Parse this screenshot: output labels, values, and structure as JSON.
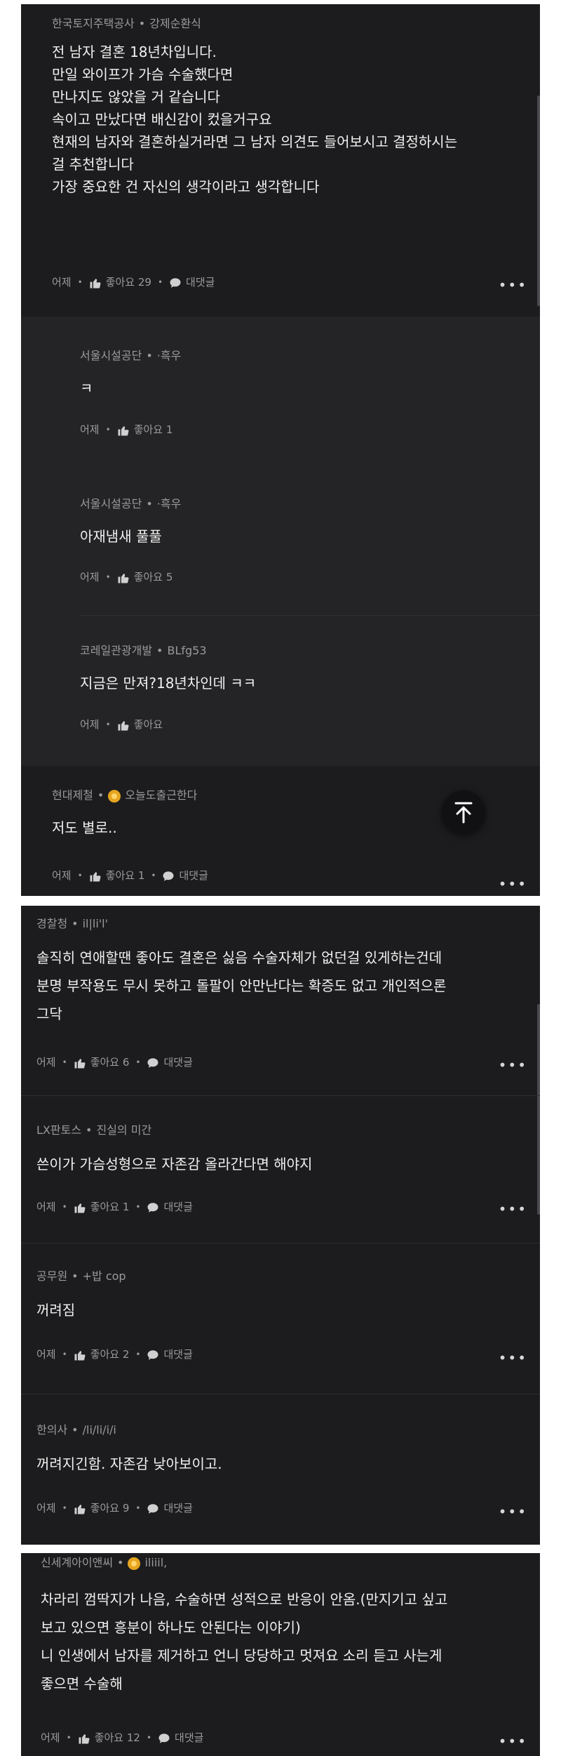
{
  "panel1": {
    "c1": {
      "company": "한국토지주택공사",
      "nick": "강제순환식",
      "lines": [
        "전 남자 결혼 18년차입니다.",
        "만일 와이프가 가슴 수술했다면",
        "만나지도 않았을 거 같습니다",
        "속이고 만났다면 배신감이 컸을거구요",
        "현재의 남자와 결혼하실거라면 그 남자 의견도 들어보시고 결정하시는",
        "걸 추천합니다",
        "가장 중요한 건 자신의 생각이라고 생각합니다"
      ],
      "time": "어제",
      "like": "좋아요 29",
      "reply": "대댓글"
    },
    "r1": {
      "company": "서울시설공단",
      "nick": "·흑우",
      "text": "ㅋ",
      "time": "어제",
      "like": "좋아요 1"
    },
    "r2": {
      "company": "서울시설공단",
      "nick": "·흑우",
      "text": "아재냄새 풀풀",
      "time": "어제",
      "like": "좋아요 5"
    },
    "r3": {
      "company": "코레일관광개발",
      "nick": "BLfg53",
      "text": "지금은 만져?18년차인데 ㅋㅋ",
      "time": "어제",
      "like": "좋아요"
    },
    "c2": {
      "company": "현대제철",
      "nick": "오늘도출근한다",
      "text": "저도 별로..",
      "time": "어제",
      "like": "좋아요 1",
      "reply": "대댓글"
    }
  },
  "panel2": {
    "c1": {
      "company": "경찰청",
      "nick": "il|li'l'",
      "lines": [
        "솔직히 연애할땐 좋아도 결혼은 싫음 수술자체가 없던걸 있게하는건데",
        "분명 부작용도 무시 못하고 돌팔이 안만난다는 확증도 없고 개인적으론",
        "그닥"
      ],
      "time": "어제",
      "like": "좋아요 6",
      "reply": "대댓글"
    },
    "c2": {
      "company": "LX판토스",
      "nick": "진실의 미간",
      "text": "쓴이가 가슴성형으로 자존감 올라간다면 해야지",
      "time": "어제",
      "like": "좋아요 1",
      "reply": "대댓글"
    },
    "c3": {
      "company": "공무원",
      "nick": "+밥 cop",
      "text": "꺼려짐",
      "time": "어제",
      "like": "좋아요 2",
      "reply": "대댓글"
    },
    "c4": {
      "company": "한의사",
      "nick": "/li/li/i/i",
      "text": "꺼려지긴함. 자존감 낮아보이고.",
      "time": "어제",
      "like": "좋아요 9",
      "reply": "대댓글"
    }
  },
  "panel3": {
    "c1": {
      "company": "신세계아이앤씨",
      "nick": "iliiil,",
      "lines": [
        "차라리 껌딱지가 나음, 수술하면 성적으로 반응이 안옴.(만지기고 싶고",
        "보고 있으면 흥분이 하나도 안된다는 이야기)",
        "니 인생에서 남자를 제거하고 언니 당당하고 멋져요 소리 듣고 사는게",
        "좋으면 수술해"
      ],
      "time": "어제",
      "like": "좋아요 12",
      "reply": "대댓글"
    }
  },
  "icons": {
    "like": "thumbs-up-icon",
    "reply": "speech-bubble-icon",
    "more": "more-dots-icon",
    "top": "arrow-up-icon",
    "badge": "flower-badge-icon"
  },
  "more_label": "•••",
  "colors": {
    "panel": "#1c1c1e",
    "reply": "#242426",
    "meta": "#9a9a9e",
    "text": "#f0f0f0",
    "badge": "#e6a51f"
  }
}
